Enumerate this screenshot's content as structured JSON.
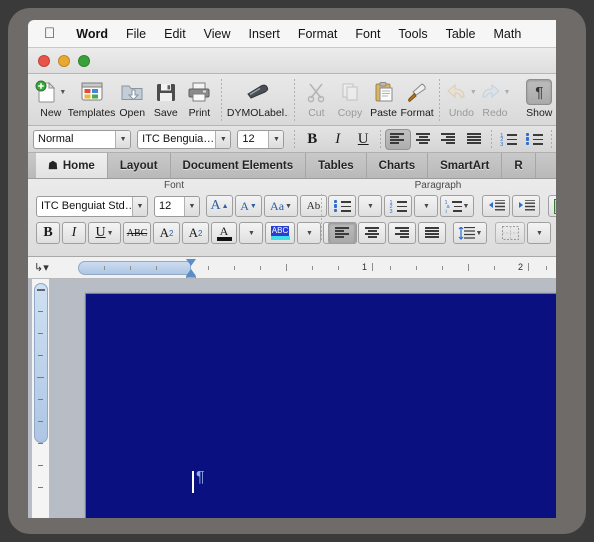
{
  "menubar": {
    "apple_icon": "apple-logo",
    "items": [
      {
        "label": "Word",
        "bold": true
      },
      {
        "label": "File",
        "bold": false
      },
      {
        "label": "Edit",
        "bold": false
      },
      {
        "label": "View",
        "bold": false
      },
      {
        "label": "Insert",
        "bold": false
      },
      {
        "label": "Format",
        "bold": false
      },
      {
        "label": "Font",
        "bold": false
      },
      {
        "label": "Tools",
        "bold": false
      },
      {
        "label": "Table",
        "bold": false
      },
      {
        "label": "Math",
        "bold": false
      }
    ]
  },
  "window": {
    "traffic_lights": [
      {
        "name": "close",
        "color": "#e8534a"
      },
      {
        "name": "minimize",
        "color": "#e9a830"
      },
      {
        "name": "zoom",
        "color": "#3aa03a"
      }
    ]
  },
  "toolbar": {
    "items": [
      {
        "label": "New",
        "icon": "new-document-icon",
        "dim": false,
        "caret": true
      },
      {
        "label": "Templates",
        "icon": "templates-icon",
        "dim": false,
        "caret": false
      },
      {
        "label": "Open",
        "icon": "open-folder-icon",
        "dim": false,
        "caret": false
      },
      {
        "label": "Save",
        "icon": "save-disk-icon",
        "dim": false,
        "caret": false
      },
      {
        "label": "Print",
        "icon": "printer-icon",
        "dim": false,
        "caret": false
      },
      {
        "label": "DYMOLabel…",
        "icon": "dymo-label-icon",
        "dim": false,
        "caret": false
      },
      {
        "label": "Cut",
        "icon": "scissors-icon",
        "dim": true,
        "caret": false
      },
      {
        "label": "Copy",
        "icon": "copy-icon",
        "dim": true,
        "caret": false
      },
      {
        "label": "Paste",
        "icon": "clipboard-icon",
        "dim": false,
        "caret": false
      },
      {
        "label": "Format",
        "icon": "format-painter-icon",
        "dim": false,
        "caret": false
      },
      {
        "label": "Undo",
        "icon": "undo-arrow-icon",
        "dim": true,
        "caret": true
      },
      {
        "label": "Redo",
        "icon": "redo-arrow-icon",
        "dim": true,
        "caret": true
      },
      {
        "label": "Show",
        "icon": "pilcrow-icon",
        "dim": false,
        "caret": false
      }
    ]
  },
  "formatbar": {
    "style": {
      "value": "Normal",
      "placeholder": "Style"
    },
    "font": {
      "value": "ITC Benguia…",
      "placeholder": "Font"
    },
    "size": {
      "value": "12",
      "placeholder": "Size"
    },
    "bold_label": "B",
    "italic_label": "I",
    "underline_label": "U"
  },
  "ribbon_tabs": {
    "items": [
      {
        "label": "Home",
        "active": true,
        "icon": "home-icon"
      },
      {
        "label": "Layout",
        "active": false,
        "icon": ""
      },
      {
        "label": "Document Elements",
        "active": false,
        "icon": ""
      },
      {
        "label": "Tables",
        "active": false,
        "icon": ""
      },
      {
        "label": "Charts",
        "active": false,
        "icon": ""
      },
      {
        "label": "SmartArt",
        "active": false,
        "icon": ""
      },
      {
        "label": "R",
        "active": false,
        "icon": ""
      }
    ]
  },
  "ribbon": {
    "font_group": {
      "title": "Font",
      "font_name": {
        "value": "ITC Benguiat Std…",
        "placeholder": "Font name"
      },
      "font_size": {
        "value": "12",
        "placeholder": "Size"
      },
      "grow_label": "A",
      "shrink_label": "A",
      "change_case_label": "Aa",
      "clear_format_label": "Ab",
      "bold_label": "B",
      "italic_label": "I",
      "underline_label": "U",
      "strikethrough_label": "ABC",
      "superscript_label": "A",
      "superscript_sup": "2",
      "subscript_label": "A",
      "subscript_sub": "2",
      "font_color_label": "A",
      "highlight_label": "ABC",
      "text_effect_label": "A"
    },
    "paragraph_group": {
      "title": "Paragraph"
    }
  },
  "ruler": {
    "tab_selector_icon": "tab-stop-icon",
    "numbers": [
      "1",
      "2"
    ],
    "unit": "inch"
  },
  "document": {
    "page_color": "#0b1080",
    "paragraph_mark": "¶",
    "cursor_visible": true
  }
}
